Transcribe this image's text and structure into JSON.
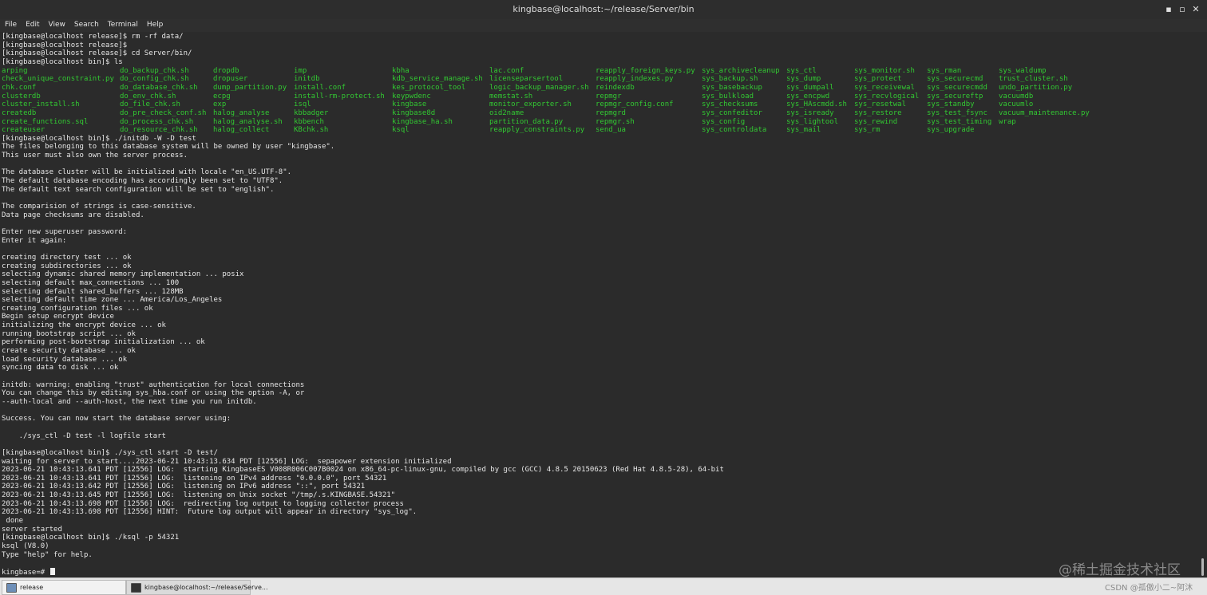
{
  "window": {
    "title": "kingbase@localhost:~/release/Server/bin",
    "controls": {
      "minimize": "▪",
      "maximize": "▫",
      "close": "✕"
    }
  },
  "menu": [
    "File",
    "Edit",
    "View",
    "Search",
    "Terminal",
    "Help"
  ],
  "colors": {
    "terminal_bg": "#2b2b2b",
    "text": "#e6e6e6",
    "listing_green": "#32c832"
  },
  "terminal": {
    "pre_lines": [
      "[kingbase@localhost release]$ rm -rf data/",
      "[kingbase@localhost release]$",
      "[kingbase@localhost release]$ cd Server/bin/",
      "[kingbase@localhost bin]$ ls"
    ],
    "ls_columns": [
      [
        "arping",
        "check_unique_constraint.py",
        "chk.conf",
        "clusterdb",
        "cluster_install.sh",
        "createdb",
        "create_functions.sql",
        "createuser"
      ],
      [
        "do_backup_chk.sh",
        "do_config_chk.sh",
        "do_database_chk.sh",
        "do_env_chk.sh",
        "do_file_chk.sh",
        "do_pre_check_conf.sh",
        "do_process_chk.sh",
        "do_resource_chk.sh"
      ],
      [
        "dropdb",
        "dropuser",
        "dump_partition.py",
        "ecpg",
        "exp",
        "halog_analyse",
        "halog_analyse.sh",
        "halog_collect"
      ],
      [
        "imp",
        "initdb",
        "install.conf",
        "install-rm-protect.sh",
        "isql",
        "kbbadger",
        "kbbench",
        "KBchk.sh"
      ],
      [
        "kbha",
        "kdb_service_manage.sh",
        "kes_protocol_tool",
        "keypwdenc",
        "kingbase",
        "kingbase8d",
        "kingbase_ha.sh",
        "ksql"
      ],
      [
        "lac.conf",
        "licenseparsertool",
        "logic_backup_manager.sh",
        "memstat.sh",
        "monitor_exporter.sh",
        "oid2name",
        "partition_data.py",
        "reapply_constraints.py"
      ],
      [
        "reapply_foreign_keys.py",
        "reapply_indexes.py",
        "reindexdb",
        "repmgr",
        "repmgr_config.conf",
        "repmgrd",
        "repmgr.sh",
        "send_ua"
      ],
      [
        "sys_archivecleanup",
        "sys_backup.sh",
        "sys_basebackup",
        "sys_bulkload",
        "sys_checksums",
        "sys_confeditor",
        "sys_config",
        "sys_controldata"
      ],
      [
        "sys_ctl",
        "sys_dump",
        "sys_dumpall",
        "sys_encpwd",
        "sys_HAscmdd.sh",
        "sys_isready",
        "sys_lightool",
        "sys_mail"
      ],
      [
        "sys_monitor.sh",
        "sys_protect",
        "sys_receivewal",
        "sys_recvlogical",
        "sys_resetwal",
        "sys_restore",
        "sys_rewind",
        "sys_rm"
      ],
      [
        "sys_rman",
        "sys_securecmd",
        "sys_securecmdd",
        "sys_secureftp",
        "sys_standby",
        "sys_test_fsync",
        "sys_test_timing",
        "sys_upgrade"
      ],
      [
        "sys_waldump",
        "trust_cluster.sh",
        "undo_partition.py",
        "vacuumdb",
        "vacuumlo",
        "vacuum_maintenance.py",
        "wrap",
        ""
      ]
    ],
    "post_lines": [
      "[kingbase@localhost bin]$ ./initdb -W -D test",
      "The files belonging to this database system will be owned by user \"kingbase\".",
      "This user must also own the server process.",
      "",
      "The database cluster will be initialized with locale \"en_US.UTF-8\".",
      "The default database encoding has accordingly been set to \"UTF8\".",
      "The default text search configuration will be set to \"english\".",
      "",
      "The comparision of strings is case-sensitive.",
      "Data page checksums are disabled.",
      "",
      "Enter new superuser password:",
      "Enter it again:",
      "",
      "creating directory test ... ok",
      "creating subdirectories ... ok",
      "selecting dynamic shared memory implementation ... posix",
      "selecting default max_connections ... 100",
      "selecting default shared_buffers ... 128MB",
      "selecting default time zone ... America/Los_Angeles",
      "creating configuration files ... ok",
      "Begin setup encrypt device",
      "initializing the encrypt device ... ok",
      "running bootstrap script ... ok",
      "performing post-bootstrap initialization ... ok",
      "create security database ... ok",
      "load security database ... ok",
      "syncing data to disk ... ok",
      "",
      "initdb: warning: enabling \"trust\" authentication for local connections",
      "You can change this by editing sys_hba.conf or using the option -A, or",
      "--auth-local and --auth-host, the next time you run initdb.",
      "",
      "Success. You can now start the database server using:",
      "",
      "    ./sys_ctl -D test -l logfile start",
      "",
      "[kingbase@localhost bin]$ ./sys_ctl start -D test/",
      "waiting for server to start....2023-06-21 10:43:13.634 PDT [12556] LOG:  sepapower extension initialized",
      "2023-06-21 10:43:13.641 PDT [12556] LOG:  starting KingbaseES V008R006C007B0024 on x86_64-pc-linux-gnu, compiled by gcc (GCC) 4.8.5 20150623 (Red Hat 4.8.5-28), 64-bit",
      "2023-06-21 10:43:13.641 PDT [12556] LOG:  listening on IPv4 address \"0.0.0.0\", port 54321",
      "2023-06-21 10:43:13.642 PDT [12556] LOG:  listening on IPv6 address \"::\", port 54321",
      "2023-06-21 10:43:13.645 PDT [12556] LOG:  listening on Unix socket \"/tmp/.s.KINGBASE.54321\"",
      "2023-06-21 10:43:13.698 PDT [12556] LOG:  redirecting log output to logging collector process",
      "2023-06-21 10:43:13.698 PDT [12556] HINT:  Future log output will appear in directory \"sys_log\".",
      " done",
      "server started",
      "[kingbase@localhost bin]$ ./ksql -p 54321",
      "ksql (V8.0)",
      "Type \"help\" for help.",
      ""
    ],
    "prompt": "kingbase=# "
  },
  "taskbar": {
    "items": [
      {
        "label": "release",
        "icon": "window-icon"
      },
      {
        "label": "kingbase@localhost:~/release/Serve...",
        "icon": "terminal-icon"
      }
    ]
  },
  "watermark": "@稀土掘金技术社区",
  "csdn_mark": "CSDN @孤傲小二~阿沐"
}
